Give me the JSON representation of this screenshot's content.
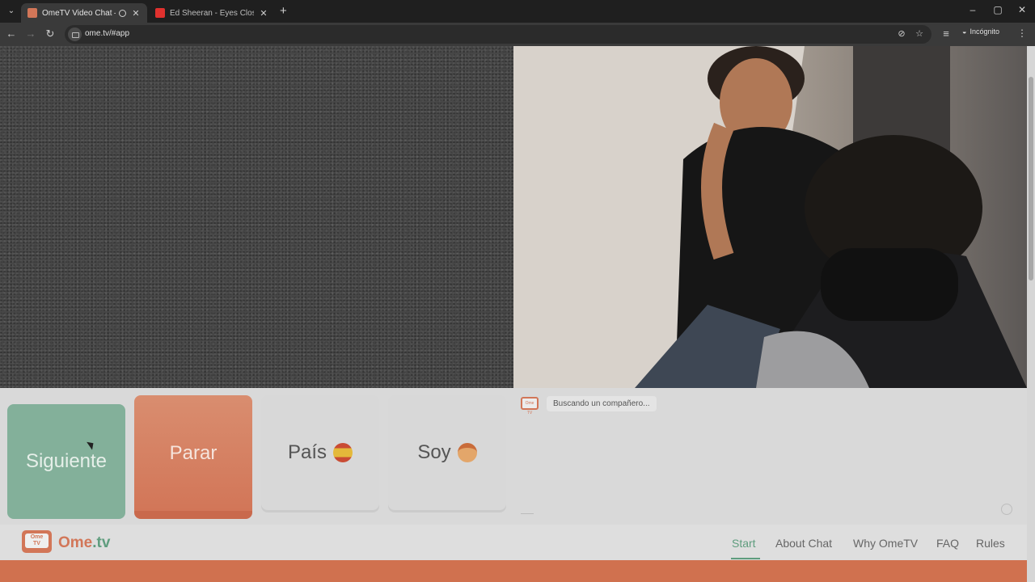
{
  "browser": {
    "tabs": [
      {
        "title": "OmeTV Video Chat — Ome",
        "active": true,
        "favicon_color": "#d27658"
      },
      {
        "title": "Ed Sheeran - Eyes Closed [Offic",
        "active": false,
        "favicon_color": "#e0312e"
      }
    ],
    "url": "ome.tv/#app",
    "profile_label": "Incógnito"
  },
  "controls": {
    "next_label": "Siguiente",
    "stop_label": "Parar",
    "country_label": "País",
    "gender_label": "Soy"
  },
  "chat": {
    "logo_text": "Ome TV",
    "status_text": "Buscando un compañero..."
  },
  "footer": {
    "logo_top": "Ome",
    "logo_bottom": "TV",
    "brand_name": "Ome",
    "brand_tld": ".tv",
    "nav": [
      "Start",
      "About Chat",
      "Why OmeTV",
      "FAQ",
      "Rules"
    ],
    "active_nav": "Start"
  },
  "colors": {
    "accent_orange": "#d27658",
    "accent_green": "#5f9d7e",
    "next_button": "#83b09a"
  },
  "icons": [
    "tab-search-icon",
    "record-icon",
    "close-icon",
    "plus-icon",
    "minimize-icon",
    "restore-icon",
    "back-icon",
    "forward-icon",
    "reload-icon",
    "eye-off-icon",
    "star-icon",
    "reading-list-icon",
    "incognito-icon",
    "more-icon",
    "flag-icon",
    "face-icon",
    "emoji-icon"
  ]
}
